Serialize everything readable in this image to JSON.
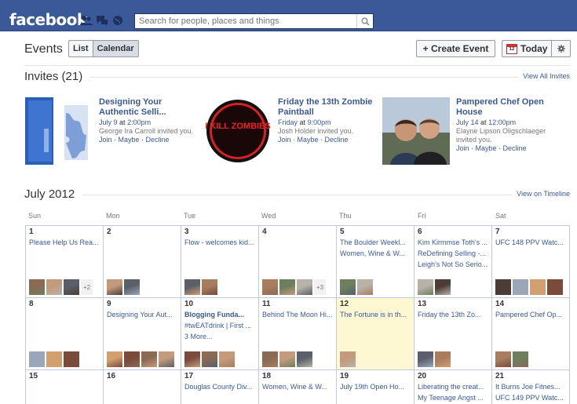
{
  "header": {
    "logo": "facebook",
    "search_placeholder": "Search for people, places and things"
  },
  "events": {
    "title": "Events",
    "view_list": "List",
    "view_calendar": "Calendar",
    "create": "+ Create Event",
    "today": "Today",
    "today_icon_number": "12"
  },
  "invites": {
    "title": "Invites (21)",
    "view_all": "View All Invites",
    "items": [
      {
        "title": "Designing Your Authentic Selli...",
        "date": "July 9",
        "time": "2:00pm",
        "by": "George Ira Carroll invited you.",
        "join": "Join",
        "maybe": "Maybe",
        "decline": "Decline"
      },
      {
        "title": "Friday the 13th Zombie Paintball",
        "date": "Friday",
        "time": "9:00pm",
        "by": "Josh Holder invited you.",
        "join": "Join",
        "maybe": "Maybe",
        "decline": "Decline",
        "badge": "I KILL ZOMBIES"
      },
      {
        "title": "Pampered Chef Open House",
        "date": "July 14",
        "time": "12:00pm",
        "by": "Elayne Lipson Oligschlaeger invited you.",
        "join": "Join",
        "maybe": "Maybe",
        "decline": "Decline"
      }
    ],
    "at": "at"
  },
  "calendar": {
    "month": "July 2012",
    "timeline": "View on Timeline",
    "days": [
      "Sun",
      "Mon",
      "Tue",
      "Wed",
      "Thu",
      "Fri",
      "Sat"
    ],
    "weeks": [
      [
        {
          "n": "1",
          "events": [
            "Please Help Us Rea..."
          ],
          "thumbs": 3,
          "more": "+2"
        },
        {
          "n": "2",
          "events": [],
          "thumbs": 2
        },
        {
          "n": "3",
          "events": [
            "Flow - welcomes kid..."
          ],
          "thumbs": 2
        },
        {
          "n": "4",
          "events": [],
          "thumbs": 3,
          "more": "+3"
        },
        {
          "n": "5",
          "events": [
            "The Boulder Weekl...",
            "Women, Wine & W..."
          ],
          "thumbs": 2
        },
        {
          "n": "6",
          "events": [
            "Kim Kirmmse Toth's ...",
            "ReDefining Selling -...",
            "Leigh's Not So Serio..."
          ],
          "thumbs": 2
        },
        {
          "n": "7",
          "events": [
            "UFC 148 PPV Watc..."
          ],
          "thumbs": 4
        }
      ],
      [
        {
          "n": "8",
          "events": [],
          "thumbs": 3
        },
        {
          "n": "9",
          "events": [
            "Designing Your Aut..."
          ],
          "thumbs": 4
        },
        {
          "n": "10",
          "events": [
            "Blogging Funda...",
            "#twEATdrink | First ...",
            "3 More..."
          ],
          "bold0": true,
          "thumbs": 3
        },
        {
          "n": "11",
          "events": [
            "Behind The Moon Hi..."
          ],
          "thumbs": 3
        },
        {
          "n": "12",
          "events": [
            "The Fortune is in th..."
          ],
          "today": true,
          "thumbs": 1
        },
        {
          "n": "13",
          "events": [
            "Friday the 13th Zo..."
          ],
          "thumbs": 2
        },
        {
          "n": "14",
          "events": [
            "Pampered Chef Op..."
          ],
          "thumbs": 2
        }
      ],
      [
        {
          "n": "15",
          "events": [],
          "thumbs": 0
        },
        {
          "n": "16",
          "events": [],
          "thumbs": 0
        },
        {
          "n": "17",
          "events": [
            "Douglas County Div..."
          ],
          "thumbs": 0
        },
        {
          "n": "18",
          "events": [
            "Women, Wine & W..."
          ],
          "thumbs": 0
        },
        {
          "n": "19",
          "events": [
            "July 19th Open Ho..."
          ],
          "thumbs": 0
        },
        {
          "n": "20",
          "events": [
            "Liberating the creat...",
            "My Teenage Angst ..."
          ],
          "thumbs": 0
        },
        {
          "n": "21",
          "events": [
            "It Burns Joe Fitnes...",
            "UFC 149 PPV Watc..."
          ],
          "thumbs": 0
        }
      ]
    ]
  },
  "colors": {
    "brand": "#3b5998",
    "today": "#fdf8d2",
    "grid": "#bfc8dc"
  }
}
